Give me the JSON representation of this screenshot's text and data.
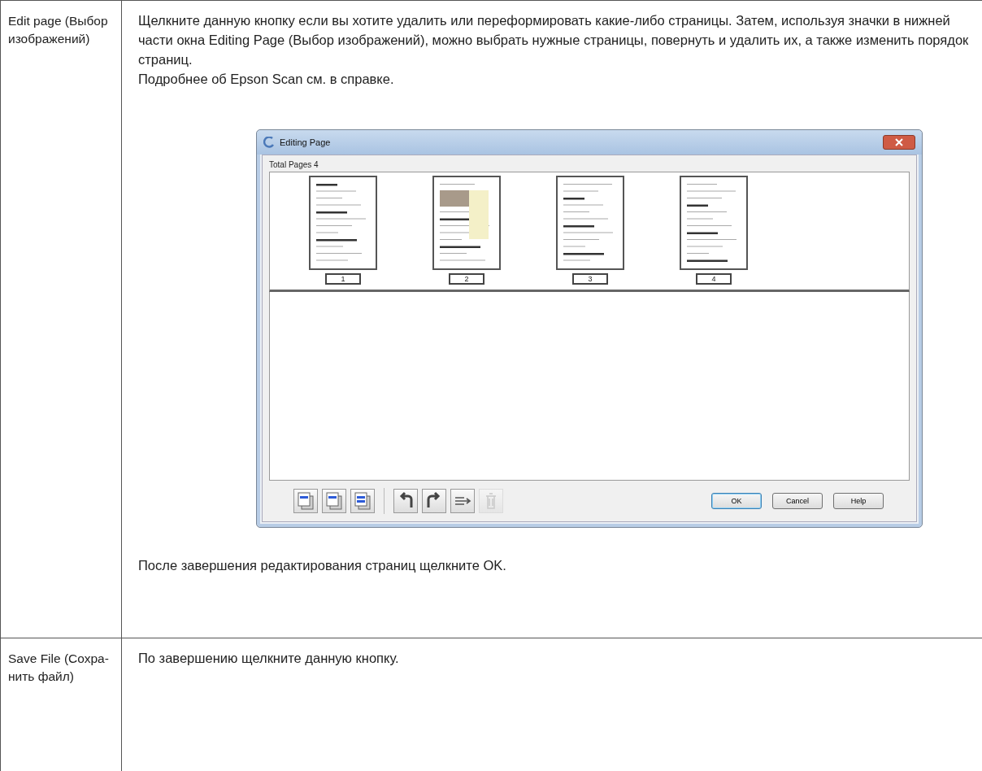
{
  "table": {
    "rows": [
      {
        "label": "Edit page (Выбор изображений)",
        "paragraphs": [
          "Щелкните данную кнопку если вы хотите удалить или переформировать какие-либо страницы. Затем, используя значки в нижней части окна Editing Page (Выбор изображений), можно выбрать нужные страницы, повернуть и удалить их, а также изменить порядок страниц.",
          "Подробнее об Epson Scan см. в справке."
        ],
        "dialog": {
          "title": "Editing Page",
          "total": "Total Pages 4",
          "pages": [
            {
              "number": "1"
            },
            {
              "number": "2"
            },
            {
              "number": "3"
            },
            {
              "number": "4"
            }
          ],
          "tools": [
            {
              "kind": "odd",
              "disabled": false
            },
            {
              "kind": "even",
              "disabled": false
            },
            {
              "kind": "all",
              "disabled": false
            },
            {
              "kind": "rotate-left",
              "disabled": false
            },
            {
              "kind": "rotate-right",
              "disabled": false
            },
            {
              "kind": "reorder",
              "disabled": false
            },
            {
              "kind": "delete",
              "disabled": true
            }
          ],
          "buttons": [
            {
              "label": "OK",
              "default": true
            },
            {
              "label": "Cancel",
              "default": false
            },
            {
              "label": "Help",
              "default": false
            }
          ]
        },
        "note": "После завершения редактирования страниц щелкните OK."
      },
      {
        "label": "Save File (Сохра-нить файл)",
        "paragraphs": [
          "По завершению щелкните данную кнопку."
        ]
      }
    ]
  }
}
